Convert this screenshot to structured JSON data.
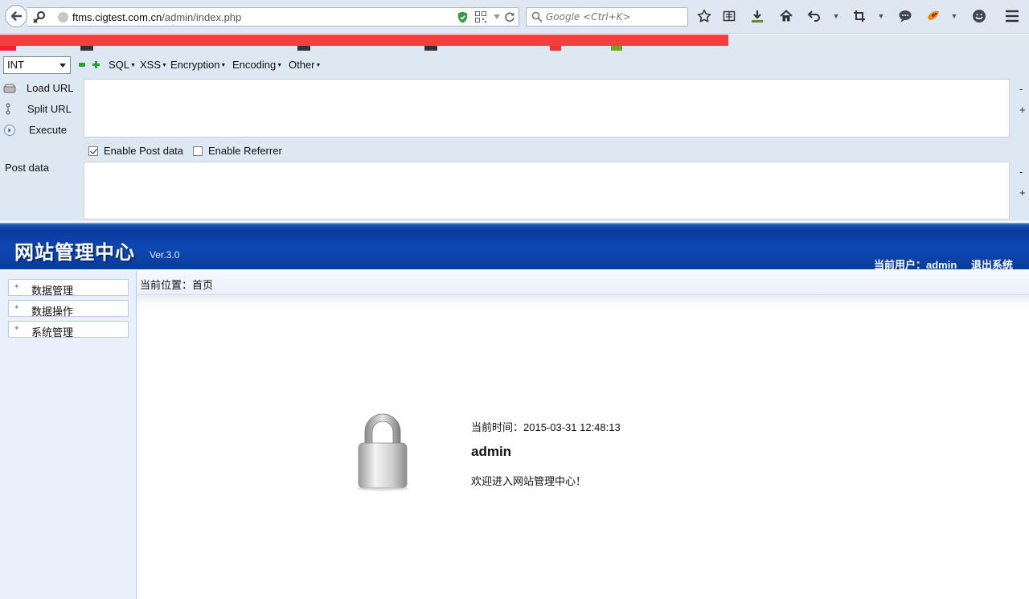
{
  "browser": {
    "url_host": "ftms.cigtest.com.cn",
    "url_path": "/admin/index.php",
    "search_placeholder": "Google <Ctrl+K>"
  },
  "hackbar": {
    "type_select": "INT",
    "menus": [
      "SQL",
      "XSS",
      "Encryption",
      "Encoding",
      "Other"
    ],
    "load_url": "Load URL",
    "split_url": "Split URL",
    "execute": "Execute",
    "enable_post": "Enable Post data",
    "enable_post_checked": true,
    "enable_referrer": "Enable Referrer",
    "enable_referrer_checked": false,
    "post_label": "Post data",
    "minus": "-",
    "plus": "+"
  },
  "admin": {
    "title": "网站管理中心",
    "version": "Ver.3.0",
    "current_user": "当前用户：admin",
    "logout": "退出系统",
    "sidebar": [
      "数据管理",
      "数据操作",
      "系统管理"
    ],
    "breadcrumb": "当前位置：首页",
    "time_text": "当前时间：2015-03-31 12:48:13",
    "username": "admin",
    "welcome": "欢迎进入网站管理中心！"
  },
  "colors": {
    "redaction": "#f53f3f",
    "header_blue": "#0a3a9c"
  },
  "icons": [
    "back-arrow-icon",
    "identity-key-icon",
    "globe-icon",
    "shield-icon",
    "qr-code-icon",
    "reload-icon",
    "search-icon",
    "star-icon",
    "reading-list-icon",
    "download-icon",
    "home-icon",
    "undo-icon",
    "crop-icon",
    "chat-icon",
    "addon-icon",
    "smiley-icon",
    "hamburger-menu-icon",
    "lock-icon"
  ]
}
